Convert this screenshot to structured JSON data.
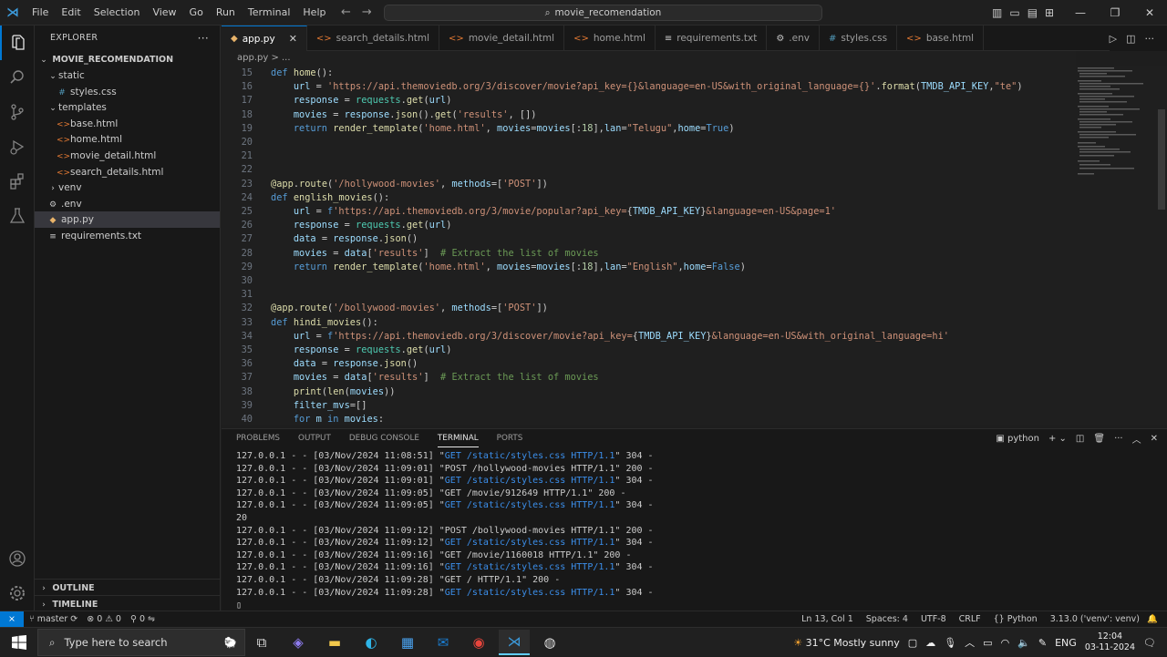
{
  "titlebar": {
    "menus": [
      "File",
      "Edit",
      "Selection",
      "View",
      "Go",
      "Run",
      "Terminal",
      "Help"
    ],
    "search": "movie_recomendation"
  },
  "explorer": {
    "title": "EXPLORER",
    "project": "MOVIE_RECOMENDATION",
    "items": [
      {
        "label": "static",
        "type": "folder-open",
        "indent": 1
      },
      {
        "label": "styles.css",
        "type": "css",
        "indent": 2
      },
      {
        "label": "templates",
        "type": "folder-open",
        "indent": 1
      },
      {
        "label": "base.html",
        "type": "html",
        "indent": 2
      },
      {
        "label": "home.html",
        "type": "html",
        "indent": 2
      },
      {
        "label": "movie_detail.html",
        "type": "html",
        "indent": 2
      },
      {
        "label": "search_details.html",
        "type": "html",
        "indent": 2
      },
      {
        "label": "venv",
        "type": "folder",
        "indent": 1
      },
      {
        "label": ".env",
        "type": "env",
        "indent": 1
      },
      {
        "label": "app.py",
        "type": "py",
        "indent": 1
      },
      {
        "label": "requirements.txt",
        "type": "txt",
        "indent": 1
      }
    ],
    "outline": "OUTLINE",
    "timeline": "TIMELINE"
  },
  "tabs": [
    {
      "label": "app.py",
      "type": "py",
      "active": true
    },
    {
      "label": "search_details.html",
      "type": "html"
    },
    {
      "label": "movie_detail.html",
      "type": "html"
    },
    {
      "label": "home.html",
      "type": "html"
    },
    {
      "label": "requirements.txt",
      "type": "txt"
    },
    {
      "label": ".env",
      "type": "env"
    },
    {
      "label": "styles.css",
      "type": "css"
    },
    {
      "label": "base.html",
      "type": "html"
    }
  ],
  "breadcrumb": "app.py > ...",
  "code": [
    {
      "n": "15",
      "html": "<span class='kw'>def</span> <span class='fn'>home</span>():"
    },
    {
      "n": "16",
      "html": "    <span class='var'>url</span> = <span class='str'>'https://api.themoviedb.org/3/discover/movie?api_key={}&amp;language=en-US&amp;with_original_language={}'</span>.<span class='fn'>format</span>(<span class='var'>TMDB_API_KEY</span>,<span class='str'>\"te\"</span>)"
    },
    {
      "n": "17",
      "html": "    <span class='var'>response</span> = <span class='cls'>requests</span>.<span class='fn'>get</span>(<span class='var'>url</span>)"
    },
    {
      "n": "18",
      "html": "    <span class='var'>movies</span> = <span class='var'>response</span>.<span class='fn'>json</span>().<span class='fn'>get</span>(<span class='str'>'results'</span>, [])"
    },
    {
      "n": "19",
      "html": "    <span class='kw'>return</span> <span class='fn'>render_template</span>(<span class='str'>'home.html'</span>, <span class='var'>movies</span>=<span class='var'>movies</span>[:<span class='num'>18</span>],<span class='var'>lan</span>=<span class='str'>\"Telugu\"</span>,<span class='var'>home</span>=<span class='kw'>True</span>)"
    },
    {
      "n": "20",
      "html": ""
    },
    {
      "n": "21",
      "html": ""
    },
    {
      "n": "22",
      "html": ""
    },
    {
      "n": "23",
      "html": "<span class='fn'>@app</span>.<span class='fn'>route</span>(<span class='str'>'/hollywood-movies'</span>, <span class='var'>methods</span>=[<span class='str'>'POST'</span>])"
    },
    {
      "n": "24",
      "html": "<span class='kw'>def</span> <span class='fn'>english_movies</span>():"
    },
    {
      "n": "25",
      "html": "    <span class='var'>url</span> = <span class='kw'>f</span><span class='str'>'https://api.themoviedb.org/3/movie/popular?api_key=</span>{<span class='var'>TMDB_API_KEY</span>}<span class='str'>&amp;language=en-US&amp;page=1'</span>"
    },
    {
      "n": "26",
      "html": "    <span class='var'>response</span> = <span class='cls'>requests</span>.<span class='fn'>get</span>(<span class='var'>url</span>)"
    },
    {
      "n": "27",
      "html": "    <span class='var'>data</span> = <span class='var'>response</span>.<span class='fn'>json</span>()"
    },
    {
      "n": "28",
      "html": "    <span class='var'>movies</span> = <span class='var'>data</span>[<span class='str'>'results'</span>]  <span class='cm'># Extract the list of movies</span>"
    },
    {
      "n": "29",
      "html": "    <span class='kw'>return</span> <span class='fn'>render_template</span>(<span class='str'>'home.html'</span>, <span class='var'>movies</span>=<span class='var'>movies</span>[:<span class='num'>18</span>],<span class='var'>lan</span>=<span class='str'>\"English\"</span>,<span class='var'>home</span>=<span class='kw'>False</span>)"
    },
    {
      "n": "30",
      "html": ""
    },
    {
      "n": "31",
      "html": ""
    },
    {
      "n": "32",
      "html": "<span class='fn'>@app</span>.<span class='fn'>route</span>(<span class='str'>'/bollywood-movies'</span>, <span class='var'>methods</span>=[<span class='str'>'POST'</span>])"
    },
    {
      "n": "33",
      "html": "<span class='kw'>def</span> <span class='fn'>hindi_movies</span>():"
    },
    {
      "n": "34",
      "html": "    <span class='var'>url</span> = <span class='kw'>f</span><span class='str'>'https://api.themoviedb.org/3/discover/movie?api_key=</span>{<span class='var'>TMDB_API_KEY</span>}<span class='str'>&amp;language=en-US&amp;with_original_language=hi'</span>"
    },
    {
      "n": "35",
      "html": "    <span class='var'>response</span> = <span class='cls'>requests</span>.<span class='fn'>get</span>(<span class='var'>url</span>)"
    },
    {
      "n": "36",
      "html": "    <span class='var'>data</span> = <span class='var'>response</span>.<span class='fn'>json</span>()"
    },
    {
      "n": "37",
      "html": "    <span class='var'>movies</span> = <span class='var'>data</span>[<span class='str'>'results'</span>]  <span class='cm'># Extract the list of movies</span>"
    },
    {
      "n": "38",
      "html": "    <span class='fn'>print</span>(<span class='fn'>len</span>(<span class='var'>movies</span>))"
    },
    {
      "n": "39",
      "html": "    <span class='var'>filter_mvs</span>=[]"
    },
    {
      "n": "40",
      "html": "    <span class='kw'>for</span> <span class='var'>m</span> <span class='kw'>in</span> <span class='var'>movies</span>:"
    }
  ],
  "panel": {
    "tabs": [
      "PROBLEMS",
      "OUTPUT",
      "DEBUG CONSOLE",
      "TERMINAL",
      "PORTS"
    ],
    "active": "TERMINAL",
    "shell": "python",
    "lines": [
      {
        "pre": "127.0.0.1 - - [03/Nov/2024 11:08:51] \"",
        "req": "GET /static/styles.css HTTP/1.1",
        "post": "\" 304 -",
        "stat": true
      },
      {
        "pre": "127.0.0.1 - - [03/Nov/2024 11:09:01] \"",
        "req": "POST /hollywood-movies HTTP/1.1",
        "post": "\" 200 -",
        "stat": false
      },
      {
        "pre": "127.0.0.1 - - [03/Nov/2024 11:09:01] \"",
        "req": "GET /static/styles.css HTTP/1.1",
        "post": "\" 304 -",
        "stat": true
      },
      {
        "pre": "127.0.0.1 - - [03/Nov/2024 11:09:05] \"",
        "req": "GET /movie/912649 HTTP/1.1",
        "post": "\" 200 -",
        "stat": false
      },
      {
        "pre": "127.0.0.1 - - [03/Nov/2024 11:09:05] \"",
        "req": "GET /static/styles.css HTTP/1.1",
        "post": "\" 304 -",
        "stat": true
      },
      {
        "pre": "20",
        "req": "",
        "post": "",
        "stat": false
      },
      {
        "pre": "127.0.0.1 - - [03/Nov/2024 11:09:12] \"",
        "req": "POST /bollywood-movies HTTP/1.1",
        "post": "\" 200 -",
        "stat": false
      },
      {
        "pre": "127.0.0.1 - - [03/Nov/2024 11:09:12] \"",
        "req": "GET /static/styles.css HTTP/1.1",
        "post": "\" 304 -",
        "stat": true
      },
      {
        "pre": "127.0.0.1 - - [03/Nov/2024 11:09:16] \"",
        "req": "GET /movie/1160018 HTTP/1.1",
        "post": "\" 200 -",
        "stat": false
      },
      {
        "pre": "127.0.0.1 - - [03/Nov/2024 11:09:16] \"",
        "req": "GET /static/styles.css HTTP/1.1",
        "post": "\" 304 -",
        "stat": true
      },
      {
        "pre": "127.0.0.1 - - [03/Nov/2024 11:09:28] \"",
        "req": "GET / HTTP/1.1",
        "post": "\" 200 -",
        "stat": false
      },
      {
        "pre": "127.0.0.1 - - [03/Nov/2024 11:09:28] \"",
        "req": "GET /static/styles.css HTTP/1.1",
        "post": "\" 304 -",
        "stat": true
      }
    ]
  },
  "status": {
    "branch": "master",
    "errors": "0",
    "warnings": "0",
    "ports": "0",
    "position": "Ln 13, Col 1",
    "spaces": "Spaces: 4",
    "encoding": "UTF-8",
    "eol": "CRLF",
    "language": "Python",
    "interpreter": "3.13.0 ('venv': venv)"
  },
  "taskbar": {
    "search_placeholder": "Type here to search",
    "weather": "31°C  Mostly sunny",
    "lang": "ENG",
    "time": "12:04",
    "date": "03-11-2024"
  },
  "colors": {
    "accent": "#0078d4",
    "editor_bg": "#1f1f1f",
    "chrome_bg": "#181818"
  }
}
